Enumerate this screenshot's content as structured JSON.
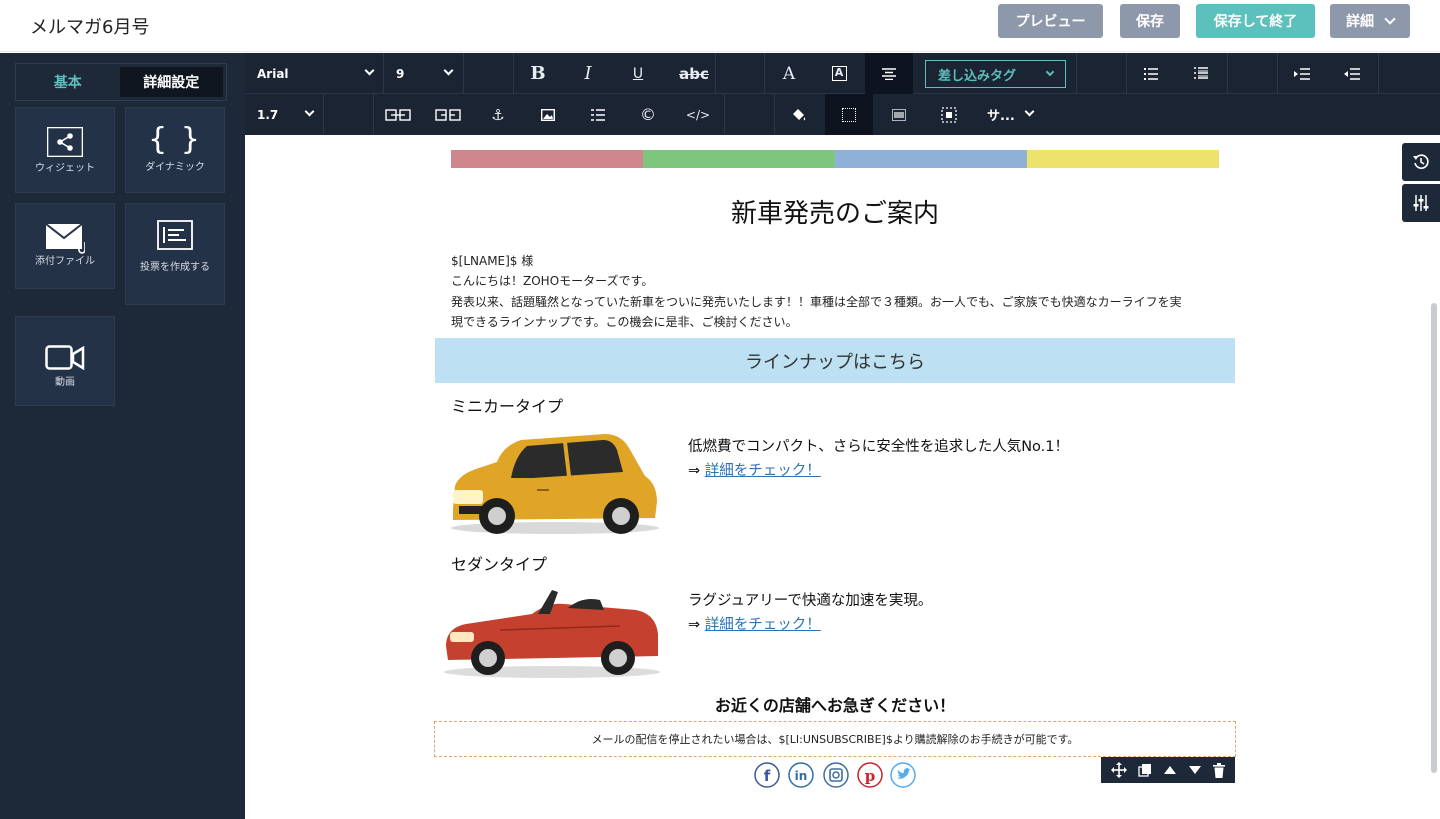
{
  "app": {
    "title": "メルマガ6月号"
  },
  "header": {
    "preview_label": "プレビュー",
    "save_label": "保存",
    "save_exit_label": "保存して終了",
    "more_label": "詳細"
  },
  "sidebar": {
    "tabs": [
      {
        "label": "基本",
        "active": false
      },
      {
        "label": "詳細設定",
        "active": true
      }
    ],
    "widgets": [
      {
        "label": "ウィジェット",
        "icon": "share-icon"
      },
      {
        "label": "ダイナミック",
        "icon": "braces-icon"
      },
      {
        "label": "添付ファイル",
        "icon": "mail-attachment-icon"
      },
      {
        "label": "投票を作成する",
        "icon": "poll-icon"
      },
      {
        "label": "動画",
        "icon": "video-camera-icon"
      }
    ]
  },
  "toolbar": {
    "font_family": "Arial",
    "font_size": "9",
    "line_height": "1.7",
    "merge_tag_label": "差し込みタグ",
    "more_short_label": "サ..."
  },
  "email": {
    "colorbar": [
      "#d0868d",
      "#7ec67e",
      "#8fb1d8",
      "#eee26c"
    ],
    "title": "新車発売のご案内",
    "greeting_name": "$[LNAME]$ 様",
    "intro_line": "こんにちは！ZOHOモーターズです。",
    "body_line1": "発表以来、話題騒然となっていた新車をついに発売いたします！！車種は全部で３種類。お一人でも、ご家族でも快適なカーライフを実",
    "body_line2": "現できるラインナップです。この機会に是非、ご検討ください。",
    "lineup_heading": "ラインナップはこちら",
    "products": [
      {
        "type": "ミニカータイプ",
        "description": "低燃費でコンパクト、さらに安全性を追求した人気No.1！",
        "arrow": "⇒",
        "link": "詳細をチェック！"
      },
      {
        "type": "セダンタイプ",
        "description": "ラグジュアリーで快適な加速を実現。",
        "arrow": "⇒",
        "link": "詳細をチェック！"
      }
    ],
    "cta": "お近くの店舗へお急ぎください！",
    "footer": "メールの配信を停止されたい場合は、$[LI:UNSUBSCRIBE]$より購読解除のお手続きが可能です。",
    "social_icons": [
      "facebook-icon",
      "linkedin-icon",
      "instagram-icon",
      "pinterest-icon",
      "twitter-icon"
    ]
  },
  "colors": {
    "sidebar_bg": "#1d2838",
    "toolbar_bg": "#1a2433",
    "accent_teal": "#5cc0bc",
    "button_gray": "#8d99ab",
    "lineup_band": "#bde1f3",
    "link": "#2f6fb5"
  }
}
